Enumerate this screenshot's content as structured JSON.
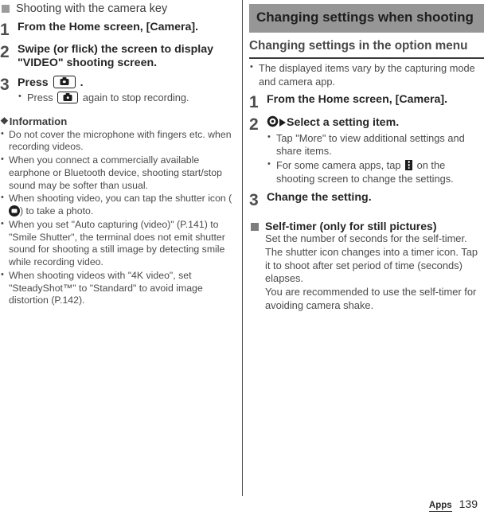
{
  "page": {
    "footer_tab": "Apps",
    "page_number": "139"
  },
  "left": {
    "section_title": "Shooting with the camera key",
    "steps": [
      {
        "num": "1",
        "title": "From the Home screen, [Camera]."
      },
      {
        "num": "2",
        "title": "Swipe (or flick) the screen to display \"VIDEO\" shooting screen."
      },
      {
        "num": "3",
        "title_before": "Press",
        "title_after": ".",
        "icon": "camera-key-icon",
        "sub_before": "Press",
        "sub_after": "again to stop recording."
      }
    ],
    "information": {
      "heading": "Information",
      "glyph": "❖",
      "items": [
        "Do not cover the microphone with fingers etc. when recording videos.",
        "When you connect a commercially available earphone or Bluetooth device, shooting start/stop sound may be softer than usual.",
        "When you set \"Auto capturing (video)\" (P.141) to \"Smile Shutter\", the terminal does not emit shutter sound for shooting a still image by detecting smile while recording video.",
        "When shooting videos with \"4K video\", set \"SteadyShot™\" to \"Standard\" to avoid image distortion (P.142)."
      ],
      "shutter_item_before": "When shooting video, you can tap the shutter icon (",
      "shutter_item_after": ") to take a photo.",
      "shutter_icon": "shutter-circle-icon"
    }
  },
  "right": {
    "banner_title": "Changing settings when shooting",
    "sub_heading": "Changing settings in the option menu",
    "intro_bullet": "The displayed items vary by the capturing mode and camera app.",
    "steps": [
      {
        "num": "1",
        "title": "From the Home screen, [Camera]."
      },
      {
        "num": "2",
        "title": "Select a setting item.",
        "icons": [
          "settings-target-icon",
          "triangle-right-icon"
        ],
        "bullets": [
          "Tap \"More\" to view additional settings and share items."
        ],
        "kebab_bullet_before": "For some camera apps, tap",
        "kebab_bullet_after": "on the shooting screen to change the settings.",
        "kebab_icon": "overflow-menu-icon"
      },
      {
        "num": "3",
        "title": "Change the setting."
      }
    ],
    "self_timer": {
      "heading": "Self-timer (only for still pictures)",
      "lines": [
        "Set the number of seconds for the self-timer.",
        "The shutter icon changes into a timer icon. Tap it to shoot after set period of time (seconds) elapses.",
        "You are recommended to use the self-timer for avoiding camera shake."
      ]
    }
  },
  "colors": {
    "banner_bg": "#969696",
    "rule": "#3a3a3a",
    "bullet_square": "#9b9b9b"
  }
}
